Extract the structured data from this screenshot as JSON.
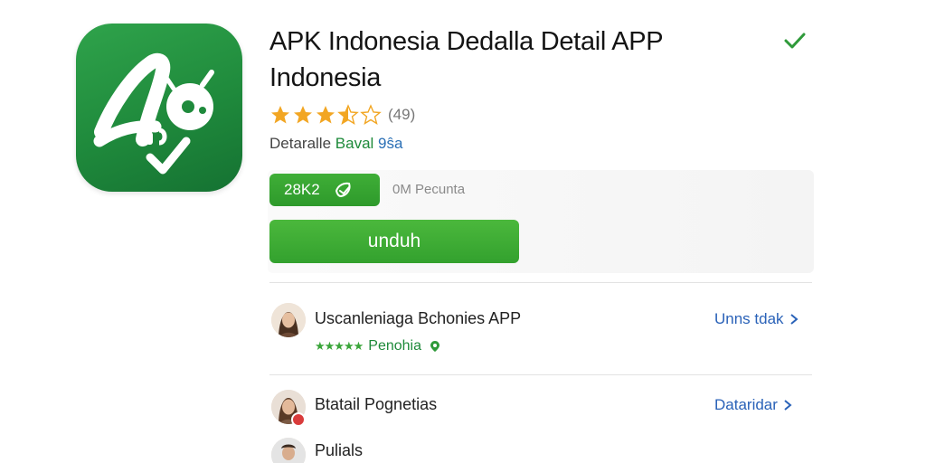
{
  "app": {
    "title": "APK Indonesia Dedalla Detail APP Indonesia",
    "icon": "app-logo-icon",
    "rating_count": "(49)",
    "rating_value": 3.5,
    "developer_prefix": "Detaralle",
    "developer_name": "Baval",
    "developer_extra": "9ŝa",
    "size": "28K2",
    "downloads": "0M Pecunta",
    "download_label": "unduh"
  },
  "colors": {
    "brand_green": "#2e9a2b",
    "star_gold": "#f2a623",
    "link_blue": "#2a62b8"
  },
  "sections": [
    {
      "title": "Uscanleniaga Bchonies APP",
      "subtitle": "Penohia",
      "stars": "★★★★★",
      "link": "Unns tdak"
    },
    {
      "title": "Btatail Pognetias",
      "link": "Dataridar"
    },
    {
      "title": "Pulials"
    }
  ]
}
